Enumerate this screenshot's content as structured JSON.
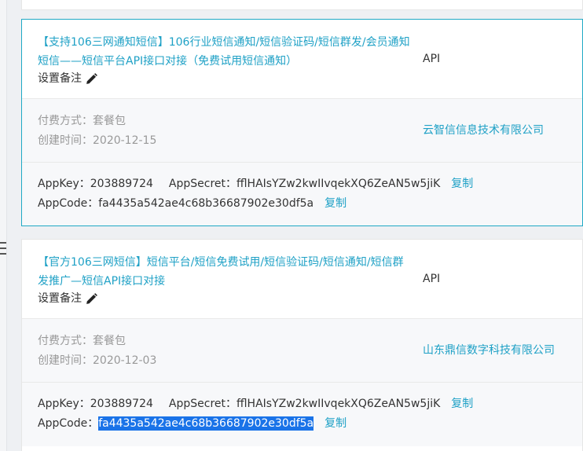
{
  "cards": [
    {
      "title": "【支持106三网通知短信】106行业短信通知/短信验证码/短信群发/会员通知短信——短信平台API接口对接（免费试用短信通知）",
      "type": "API",
      "remark_label": "设置备注",
      "payment_label": "付费方式：",
      "payment_value": "套餐包",
      "created_label": "创建时间：",
      "created_value": "2020-12-15",
      "company": "云智信信息技术有限公司",
      "appkey_label": "AppKey：",
      "appkey_value": "203889724",
      "appsecret_label": "AppSecret：",
      "appsecret_value": "fflHAIsYZw2kwIIvqekXQ6ZeAN5w5jiK",
      "appcode_label": "AppCode：",
      "appcode_value": "fa4435a542ae4c68b36687902e30df5a",
      "copy_label": "复制"
    },
    {
      "title": "【官方106三网短信】短信平台/短信免费试用/短信验证码/短信通知/短信群发推广—短信API接口对接",
      "type": "API",
      "remark_label": "设置备注",
      "payment_label": "付费方式：",
      "payment_value": "套餐包",
      "created_label": "创建时间：",
      "created_value": "2020-12-03",
      "company": "山东鼎信数字科技有限公司",
      "appkey_label": "AppKey：",
      "appkey_value": "203889724",
      "appsecret_label": "AppSecret：",
      "appsecret_value": "fflHAIsYZw2kwIIvqekXQ6ZeAN5w5jiK",
      "appcode_label": "AppCode：",
      "appcode_value": "fa4435a542ae4c68b36687902e30df5a",
      "copy_label": "复制"
    }
  ],
  "icons": {
    "edit": "pencil-icon",
    "menu": "hamburger-icon"
  },
  "colors": {
    "accent": "#1fa1c6",
    "active_border": "#1fa9c5",
    "selection": "#1a73e8"
  }
}
